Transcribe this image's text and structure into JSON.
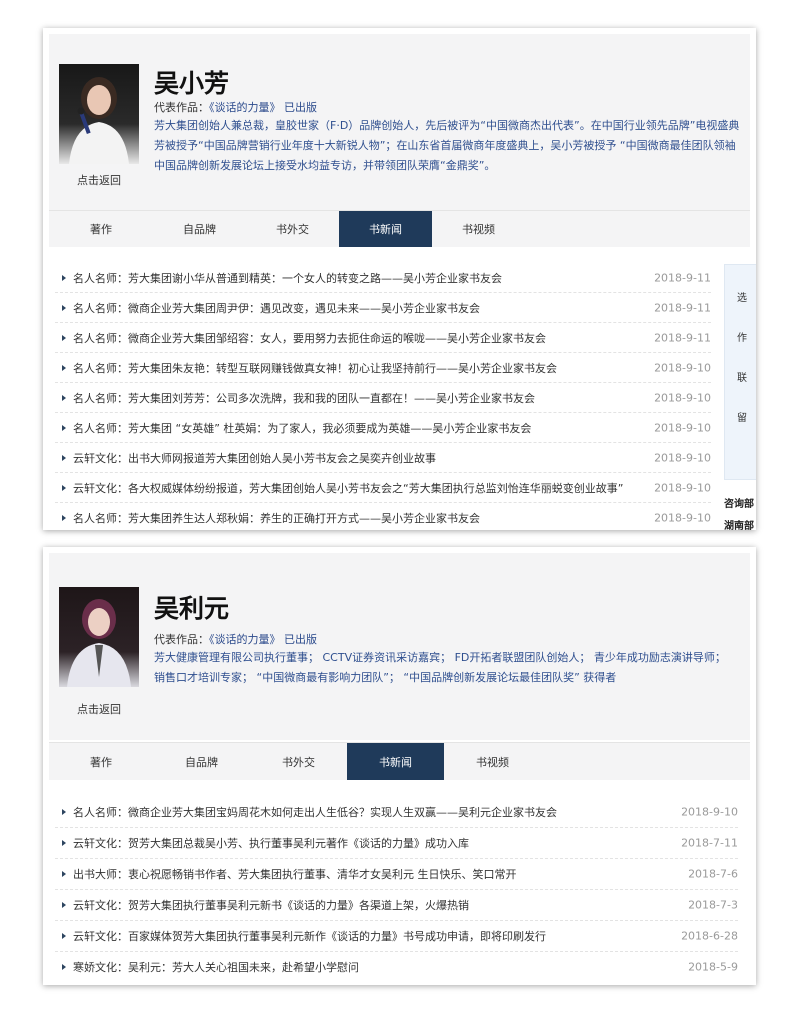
{
  "person1": {
    "name": "吴小芳",
    "works_label": "代表作品：",
    "works_title": "《谈话的力量》",
    "works_status": "已出版",
    "back": "点击返回",
    "bio_lines": [
      "芳大集团创始人兼总裁，皇胶世家（F·D）品牌创始人，先后被评为“中国微商杰出代表”。在中国行业领先品牌”电视盛典",
      "芳被授予“中国品牌营销行业年度十大新锐人物”；在山东省首届微商年度盛典上，吴小芳被授予 “中国微商最佳团队领袖",
      "中国品牌创新发展论坛上接受水均益专访，并带领团队荣膺“金鼎奖”。"
    ],
    "tabs": [
      "著作",
      "自品牌",
      "书外交",
      "书新闻",
      "书视频"
    ],
    "news": [
      {
        "text": "名人名师：芳大集团谢小华从普通到精英：一个女人的转变之路——吴小芳企业家书友会",
        "date": "2018-9-11"
      },
      {
        "text": "名人名师：微商企业芳大集团周尹伊：遇见改变，遇见未来——吴小芳企业家书友会",
        "date": "2018-9-11"
      },
      {
        "text": "名人名师：微商企业芳大集团邹绍容：女人，要用努力去扼住命运的喉咙——吴小芳企业家书友会",
        "date": "2018-9-11"
      },
      {
        "text": "名人名师：芳大集团朱友艳：转型互联网赚钱做真女神！初心让我坚持前行——吴小芳企业家书友会",
        "date": "2018-9-10"
      },
      {
        "text": "名人名师：芳大集团刘芳芳：公司多次洗牌，我和我的团队一直都在！——吴小芳企业家书友会",
        "date": "2018-9-10"
      },
      {
        "text": "名人名师：芳大集团 “女英雄” 杜英娟：为了家人，我必须要成为英雄——吴小芳企业家书友会",
        "date": "2018-9-10"
      },
      {
        "text": "云轩文化：出书大师网报道芳大集团创始人吴小芳书友会之吴奕卉创业故事",
        "date": "2018-9-10"
      },
      {
        "text": "云轩文化：各大权威媒体纷纷报道，芳大集团创始人吴小芳书友会之“芳大集团执行总监刘怡连华丽蜕变创业故事”",
        "date": "2018-9-10"
      },
      {
        "text": "名人名师：芳大集团养生达人郑秋娟：养生的正确打开方式——吴小芳企业家书友会",
        "date": "2018-9-10"
      }
    ],
    "side_items": [
      "选",
      "作",
      "联",
      "留"
    ],
    "side_title": "咨询部",
    "side_title2": "湖南部"
  },
  "person2": {
    "name": "吴利元",
    "works_label": "代表作品：",
    "works_title": "《谈话的力量》",
    "works_status": "已出版",
    "back": "点击返回",
    "bio_lines": [
      "芳大健康管理有限公司执行董事； CCTV证券资讯采访嘉宾； FD开拓者联盟团队创始人； 青少年成功励志演讲导师；",
      "销售口才培训专家； “中国微商最有影响力团队”； “中国品牌创新发展论坛最佳团队奖” 获得者"
    ],
    "tabs": [
      "著作",
      "自品牌",
      "书外交",
      "书新闻",
      "书视频"
    ],
    "news": [
      {
        "text": "名人名师：微商企业芳大集团宝妈周花木如何走出人生低谷？实现人生双赢——吴利元企业家书友会",
        "date": "2018-9-10"
      },
      {
        "text": "云轩文化：贺芳大集团总裁吴小芳、执行董事吴利元著作《谈话的力量》成功入库",
        "date": "2018-7-11"
      },
      {
        "text": "出书大师：衷心祝愿畅销书作者、芳大集团执行董事、清华才女吴利元 生日快乐、笑口常开",
        "date": "2018-7-6"
      },
      {
        "text": "云轩文化：贺芳大集团执行董事吴利元新书《谈话的力量》各渠道上架，火爆热销",
        "date": "2018-7-3"
      },
      {
        "text": "云轩文化：百家媒体贺芳大集团执行董事吴利元新作《谈话的力量》书号成功申请，即将印刷发行",
        "date": "2018-6-28"
      },
      {
        "text": "寒娇文化：吴利元：芳大人关心祖国未来，赴希望小学慰问",
        "date": "2018-5-9"
      }
    ]
  },
  "colors": {
    "active_tab": "#1f3a5a",
    "link": "#2f4f8f",
    "date": "#9a9a9a"
  }
}
